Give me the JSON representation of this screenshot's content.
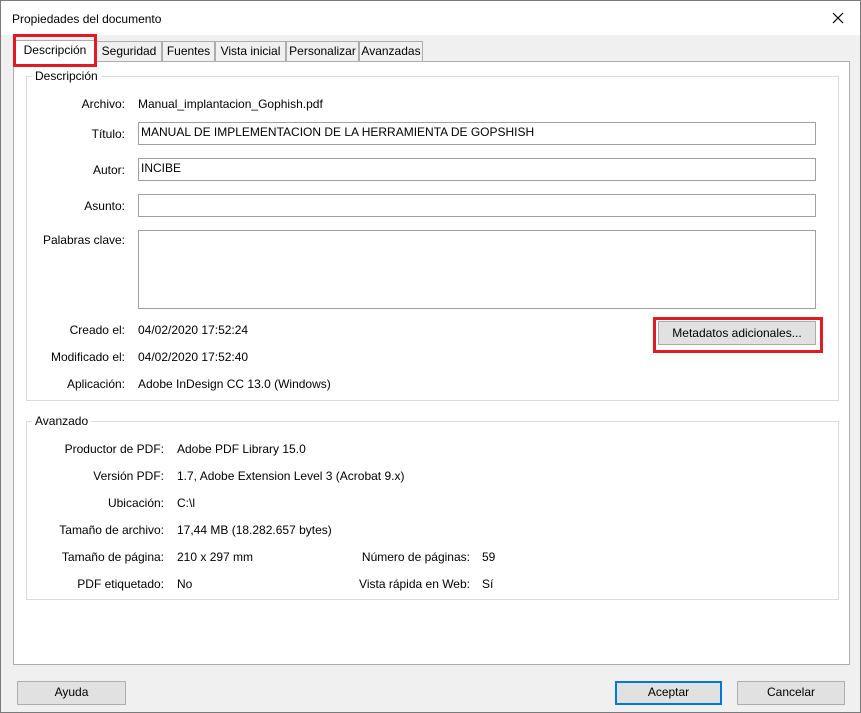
{
  "window": {
    "title": "Propiedades del documento"
  },
  "tabs": [
    {
      "label": "Descripción"
    },
    {
      "label": "Seguridad"
    },
    {
      "label": "Fuentes"
    },
    {
      "label": "Vista inicial"
    },
    {
      "label": "Personalizar"
    },
    {
      "label": "Avanzadas"
    }
  ],
  "description": {
    "legend": "Descripción",
    "file_label": "Archivo:",
    "file_value": "Manual_implantacion_Gophish.pdf",
    "title_label": "Título:",
    "title_value": "MANUAL DE IMPLEMENTACION DE LA HERRAMIENTA DE GOPSHISH",
    "author_label": "Autor:",
    "author_value": "INCIBE",
    "subject_label": "Asunto:",
    "subject_value": "",
    "keywords_label": "Palabras clave:",
    "keywords_value": "",
    "created_label": "Creado el:",
    "created_value": "04/02/2020 17:52:24",
    "modified_label": "Modificado el:",
    "modified_value": "04/02/2020 17:52:40",
    "app_label": "Aplicación:",
    "app_value": "Adobe InDesign CC 13.0 (Windows)",
    "metadata_button": "Metadatos adicionales..."
  },
  "advanced": {
    "legend": "Avanzado",
    "producer_label": "Productor de PDF:",
    "producer_value": "Adobe PDF Library 15.0",
    "version_label": "Versión PDF:",
    "version_value": "1.7, Adobe Extension Level 3 (Acrobat 9.x)",
    "location_label": "Ubicación:",
    "location_value": "C:\\l",
    "filesize_label": "Tamaño de archivo:",
    "filesize_value": "17,44 MB (18.282.657 bytes)",
    "pagesize_label": "Tamaño de página:",
    "pagesize_value": "210 x 297 mm",
    "pages_label": "Número de páginas:",
    "pages_value": "59",
    "tagged_label": "PDF etiquetado:",
    "tagged_value": "No",
    "fastweb_label": "Vista rápida en Web:",
    "fastweb_value": "Sí"
  },
  "buttons": {
    "help": "Ayuda",
    "ok": "Aceptar",
    "cancel": "Cancelar"
  },
  "colors": {
    "highlight": "#e01b24",
    "default_button_border": "#0078d7"
  }
}
